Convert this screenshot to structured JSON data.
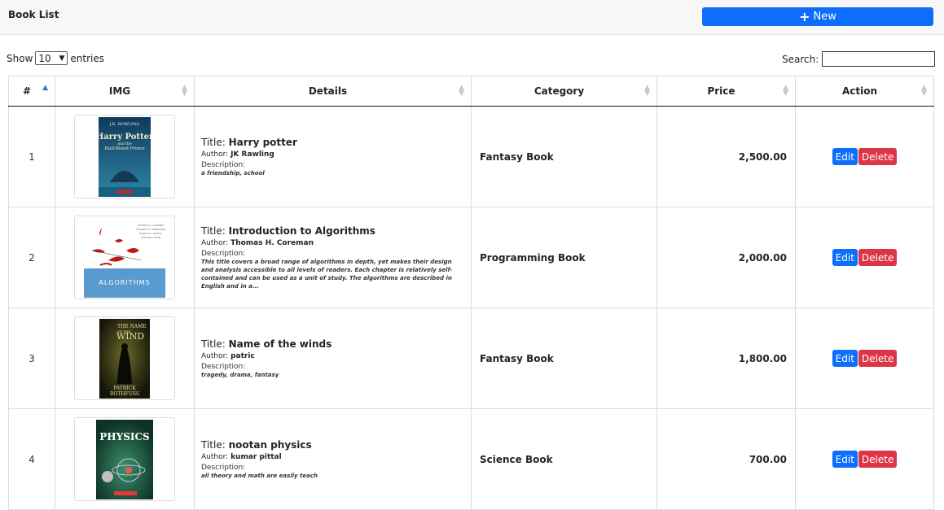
{
  "header": {
    "title": "Book List",
    "new_label": "New"
  },
  "controls": {
    "show_label": "Show",
    "entries_value": "10",
    "entries_label": "entries",
    "search_label": "Search:",
    "search_value": ""
  },
  "table": {
    "columns": [
      "#",
      "IMG",
      "Details",
      "Category",
      "Price",
      "Action"
    ],
    "title_label": "Title:",
    "author_label": "Author:",
    "description_label": "Description:",
    "edit_label": "Edit",
    "delete_label": "Delete",
    "rows": [
      {
        "num": "1",
        "title": "Harry potter",
        "author": "JK Rawling",
        "description": "a friendship, school",
        "category": "Fantasy Book",
        "price": "2,500.00",
        "cover": {
          "icon": "harry-potter-cover",
          "lines": [
            "J.K. ROWLING",
            "Harry Potter",
            "and the",
            "Half-Blood Prince"
          ]
        }
      },
      {
        "num": "2",
        "title": "Introduction to Algorithms",
        "author": "Thomas H. Coreman",
        "description": "This title covers a broad range of algorithms in depth, yet makes their design and analysis accessible to all levels of readers. Each chapter is relatively self-contained and can be used as a unit of study. The algorithms are described in English and in a...",
        "category": "Programming Book",
        "price": "2,000.00",
        "cover": {
          "icon": "algorithms-cover",
          "lines": [
            "ALGORITHMS"
          ]
        }
      },
      {
        "num": "3",
        "title": "Name of the winds",
        "author": "patric",
        "description": "tragedy, drama, fantasy",
        "category": "Fantasy Book",
        "price": "1,800.00",
        "cover": {
          "icon": "name-of-the-wind-cover",
          "lines": [
            "THE NAME",
            "OF THE",
            "WIND",
            "PATRICK",
            "ROTHFUSS"
          ]
        }
      },
      {
        "num": "4",
        "title": "nootan physics",
        "author": "kumar pittal",
        "description": "all theory and math are easily teach",
        "category": "Science Book",
        "price": "700.00",
        "cover": {
          "icon": "physics-cover",
          "lines": [
            "PHYSICS"
          ]
        }
      }
    ]
  },
  "colors": {
    "primary": "#0d6efd",
    "danger": "#dc3545"
  }
}
